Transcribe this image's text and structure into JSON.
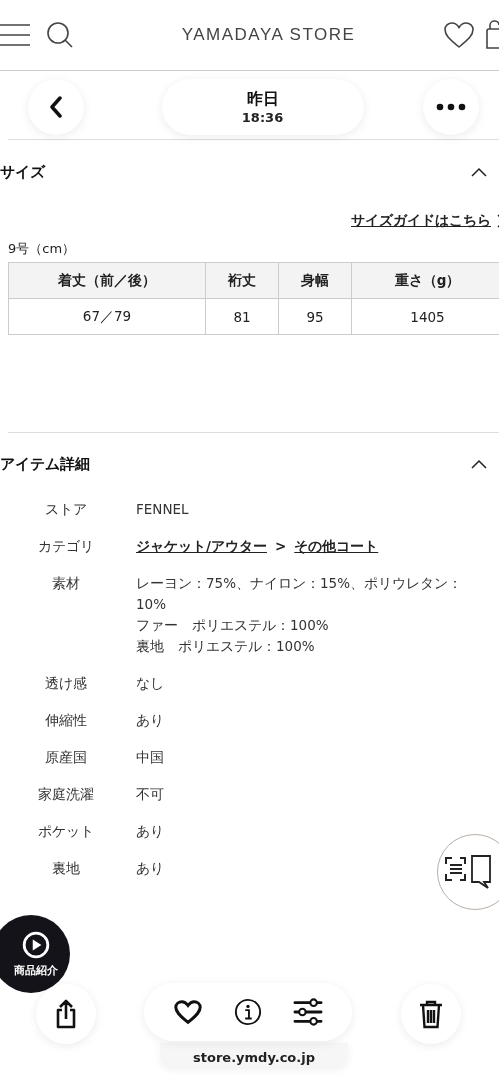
{
  "header": {
    "logo": "YAMADAYA STORE"
  },
  "nav": {
    "title": "昨日",
    "time": "18:36"
  },
  "size_section": {
    "title": "サイズ",
    "expanded": true,
    "guide_link": "サイズガイドはこちら",
    "unit_label": "9号（cm）",
    "columns": [
      "着丈（前／後）",
      "裄丈",
      "身幅",
      "重さ（g）"
    ],
    "rows": [
      [
        "67／79",
        "81",
        "95",
        "1405"
      ]
    ]
  },
  "detail_section": {
    "title": "アイテム詳細",
    "expanded": true,
    "rows": [
      {
        "label": "ストア",
        "kind": "text",
        "lines": [
          "FENNEL"
        ]
      },
      {
        "label": "カテゴリ",
        "kind": "links",
        "links": [
          "ジャケット/アウター",
          "その他コート"
        ],
        "separator": ">"
      },
      {
        "label": "素材",
        "kind": "text",
        "lines": [
          "レーヨン：75%、ナイロン：15%、ポリウレタン：10%",
          "ファー　ポリエステル：100%",
          "裏地　ポリエステル：100%"
        ]
      },
      {
        "label": "透け感",
        "kind": "text",
        "lines": [
          "なし"
        ]
      },
      {
        "label": "伸縮性",
        "kind": "text",
        "lines": [
          "あり"
        ]
      },
      {
        "label": "原産国",
        "kind": "text",
        "lines": [
          "中国"
        ]
      },
      {
        "label": "家庭洗濯",
        "kind": "text",
        "lines": [
          "不可"
        ]
      },
      {
        "label": "ポケット",
        "kind": "text",
        "lines": [
          "あり"
        ]
      },
      {
        "label": "裏地",
        "kind": "text",
        "lines": [
          "あり"
        ]
      }
    ]
  },
  "video_button": {
    "label": "商品紹介"
  },
  "url_bar": {
    "url": "store.ymdy.co.jp"
  }
}
